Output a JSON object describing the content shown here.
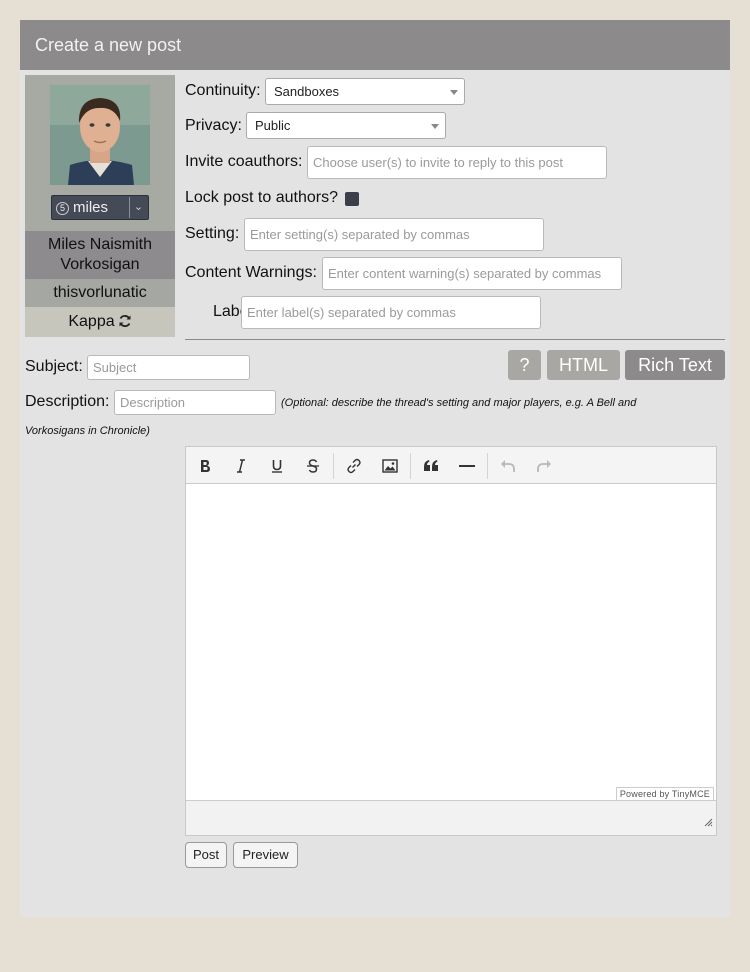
{
  "header": {
    "title": "Create a new post"
  },
  "character": {
    "icon_number": "5",
    "icon_keyword": "miles",
    "name": "Miles Naismith Vorkosigan",
    "screenname": "thisvorlunatic",
    "alias": "Kappa"
  },
  "form": {
    "continuity_label": "Continuity:",
    "continuity_value": "Sandboxes",
    "privacy_label": "Privacy:",
    "privacy_value": "Public",
    "coauthors_label": "Invite coauthors:",
    "coauthors_placeholder": "Choose user(s) to invite to reply to this post",
    "lock_label": "Lock post to authors?",
    "setting_label": "Setting:",
    "setting_placeholder": "Enter setting(s) separated by commas",
    "warnings_label": "Content Warnings:",
    "warnings_placeholder": "Enter content warning(s) separated by commas",
    "labels_label": "Labels:",
    "labels_placeholder": "Enter label(s) separated by commas",
    "subject_label": "Subject:",
    "subject_placeholder": "Subject",
    "description_label": "Description:",
    "description_placeholder": "Description",
    "description_hint_1": "(Optional: describe the thread's setting and major players, e.g. A Bell and",
    "description_hint_2": "Vorkosigans in Chronicle)"
  },
  "editor_modes": {
    "help": "?",
    "html": "HTML",
    "rich": "Rich Text"
  },
  "editor": {
    "powered_by": "Powered by TinyMCE"
  },
  "toolbar_icons": [
    "bold-icon",
    "italic-icon",
    "underline-icon",
    "strikethrough-icon",
    "link-icon",
    "image-icon",
    "blockquote-icon",
    "horizontal-rule-icon",
    "undo-icon",
    "redo-icon"
  ],
  "actions": {
    "post": "Post",
    "preview": "Preview"
  },
  "colors": {
    "header": "#8c8a8b",
    "panel": "#e3e3e3",
    "page": "#e6dfd3",
    "active_mode": "#8c8a8b",
    "inactive_mode": "#a9a7a3"
  }
}
